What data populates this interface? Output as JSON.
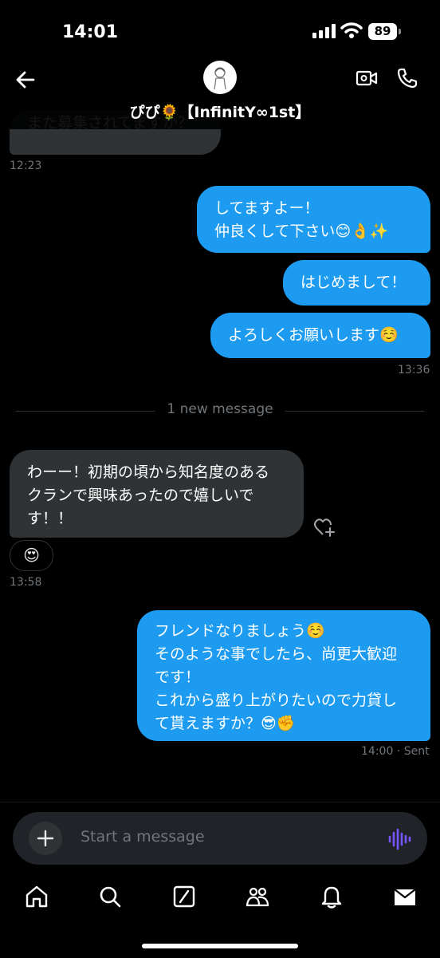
{
  "status_bar": {
    "time": "14:01",
    "battery": "89"
  },
  "header": {
    "title": "ぴぴ🌻【InfinitY∞1st】",
    "back_icon": "arrow-left-icon",
    "video_icon": "video-call-icon",
    "phone_icon": "phone-icon"
  },
  "messages": [
    {
      "side": "in",
      "text": "また募集されてますか？",
      "time": "12:23"
    },
    {
      "side": "out",
      "text": "してますよー！\n仲良くして下さい😊👌✨"
    },
    {
      "side": "out",
      "text": "はじめまして！"
    },
    {
      "side": "out",
      "text": "よろしくお願いします☺️",
      "time": "13:36"
    },
    {
      "side": "in",
      "text": "わーー！初期の頃から知名度のある\nクランで興味あったので嬉しいで\nす！！",
      "time": "13:58",
      "reaction": "😍"
    },
    {
      "side": "out",
      "text": "フレンドなりましょう☺️\nそのような事でしたら、尚更大歓迎\nです！\nこれから盛り上がりたいので力貸し\nて貰えますか？😎✊",
      "time": "14:00 · Sent"
    }
  ],
  "divider": {
    "label": "1 new message"
  },
  "composer": {
    "placeholder": "Start a message"
  },
  "bottom_nav": [
    "home-icon",
    "search-icon",
    "grok-icon",
    "communities-icon",
    "notifications-icon",
    "messages-icon"
  ],
  "colors": {
    "background": "#000000",
    "outgoing_bubble": "#1d9bf0",
    "incoming_bubble": "#2f3336",
    "voice_accent": "#7856ff"
  }
}
